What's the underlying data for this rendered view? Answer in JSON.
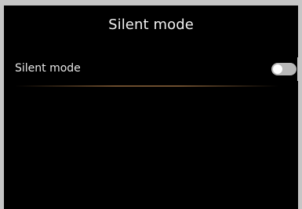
{
  "header": {
    "title": "Silent mode"
  },
  "settings": {
    "silent_mode": {
      "label": "Silent mode",
      "enabled": false
    }
  },
  "colors": {
    "background": "#000000",
    "text": "#f2f2f2",
    "toggle_track": "#b8b8b8",
    "divider_accent": "#cd9155"
  }
}
